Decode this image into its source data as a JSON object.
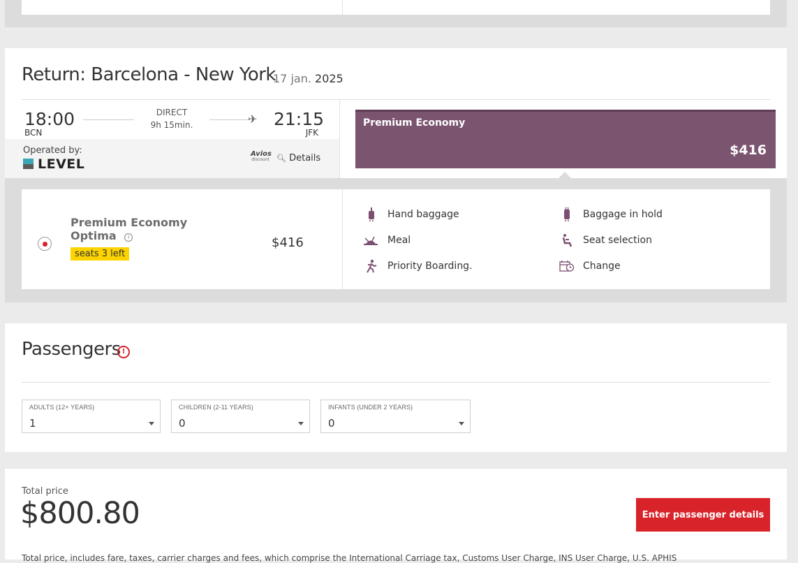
{
  "segment": {
    "title": "Return: Barcelona - New York",
    "date_day": "17 jan.",
    "date_year": "2025",
    "departure_time": "18:00",
    "departure_code": "BCN",
    "flight_type": "DIRECT",
    "duration": "9h 15min.",
    "arrival_time": "21:15",
    "arrival_code": "JFK",
    "operated_by_label": "Operated by:",
    "operator_name": "LEVEL",
    "avios_top": "Avios",
    "avios_bottom": "discount",
    "details_label": "Details"
  },
  "cabin": {
    "name": "Premium Economy",
    "price": "$416"
  },
  "fare": {
    "name_line1": "Premium Economy",
    "name_line2": "Optima",
    "seats_left": "seats 3 left",
    "price": "$416"
  },
  "features": [
    {
      "icon": "hand-baggage-icon",
      "label": "Hand baggage"
    },
    {
      "icon": "baggage-in-hold-icon",
      "label": "Baggage in hold"
    },
    {
      "icon": "meal-icon",
      "label": "Meal"
    },
    {
      "icon": "seat-selection-icon",
      "label": "Seat selection"
    },
    {
      "icon": "priority-boarding-icon",
      "label": "Priority Boarding."
    },
    {
      "icon": "change-icon",
      "label": "Change"
    }
  ],
  "passengers": {
    "title": "Passengers",
    "adults": {
      "label": "ADULTS (12+ YEARS)",
      "value": "1"
    },
    "children": {
      "label": "CHILDREN (2-11 YEARS)",
      "value": "0"
    },
    "infants": {
      "label": "INFANTS (UNDER 2 YEARS)",
      "value": "0"
    }
  },
  "total": {
    "label": "Total price",
    "amount": "$800.80",
    "cta": "Enter passenger details",
    "disclaimer": "Total price, includes fare, taxes, carrier charges and fees, which comprise the International Carriage tax, Customs User Charge, INS User Charge, U.S. APHIS"
  },
  "colors": {
    "accent_purple": "#7b5570",
    "cta_red": "#d8232a",
    "badge_yellow": "#fdd400",
    "level_teal": "#3aa7b4"
  }
}
